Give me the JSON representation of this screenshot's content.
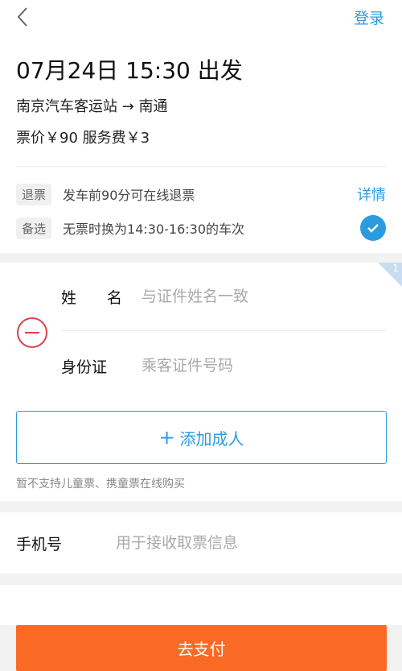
{
  "header": {
    "login_label": "登录"
  },
  "trip": {
    "departure": "07月24日 15:30 出发",
    "route": "南京汽车客运站 → 南通",
    "price": "票价￥90 服务费￥3"
  },
  "policies": {
    "refund": {
      "tag": "退票",
      "text": "发车前90分可在线退票",
      "details_label": "详情"
    },
    "backup": {
      "tag": "备选",
      "text": "无票时换为14:30-16:30的车次",
      "checked": true
    }
  },
  "passenger": {
    "index": "1",
    "name_label": "姓 名",
    "name_placeholder": "与证件姓名一致",
    "id_label": "身份证",
    "id_placeholder": "乘客证件号码",
    "add_adult_label": "添加成人",
    "child_note": "暂不支持儿童票、携童票在线购买"
  },
  "contact": {
    "phone_label": "手机号",
    "phone_placeholder": "用于接收取票信息"
  },
  "footer": {
    "pay_label": "去支付"
  },
  "colors": {
    "accent": "#2b9be0",
    "pay": "#fb6a25",
    "remove": "#e0404a"
  }
}
